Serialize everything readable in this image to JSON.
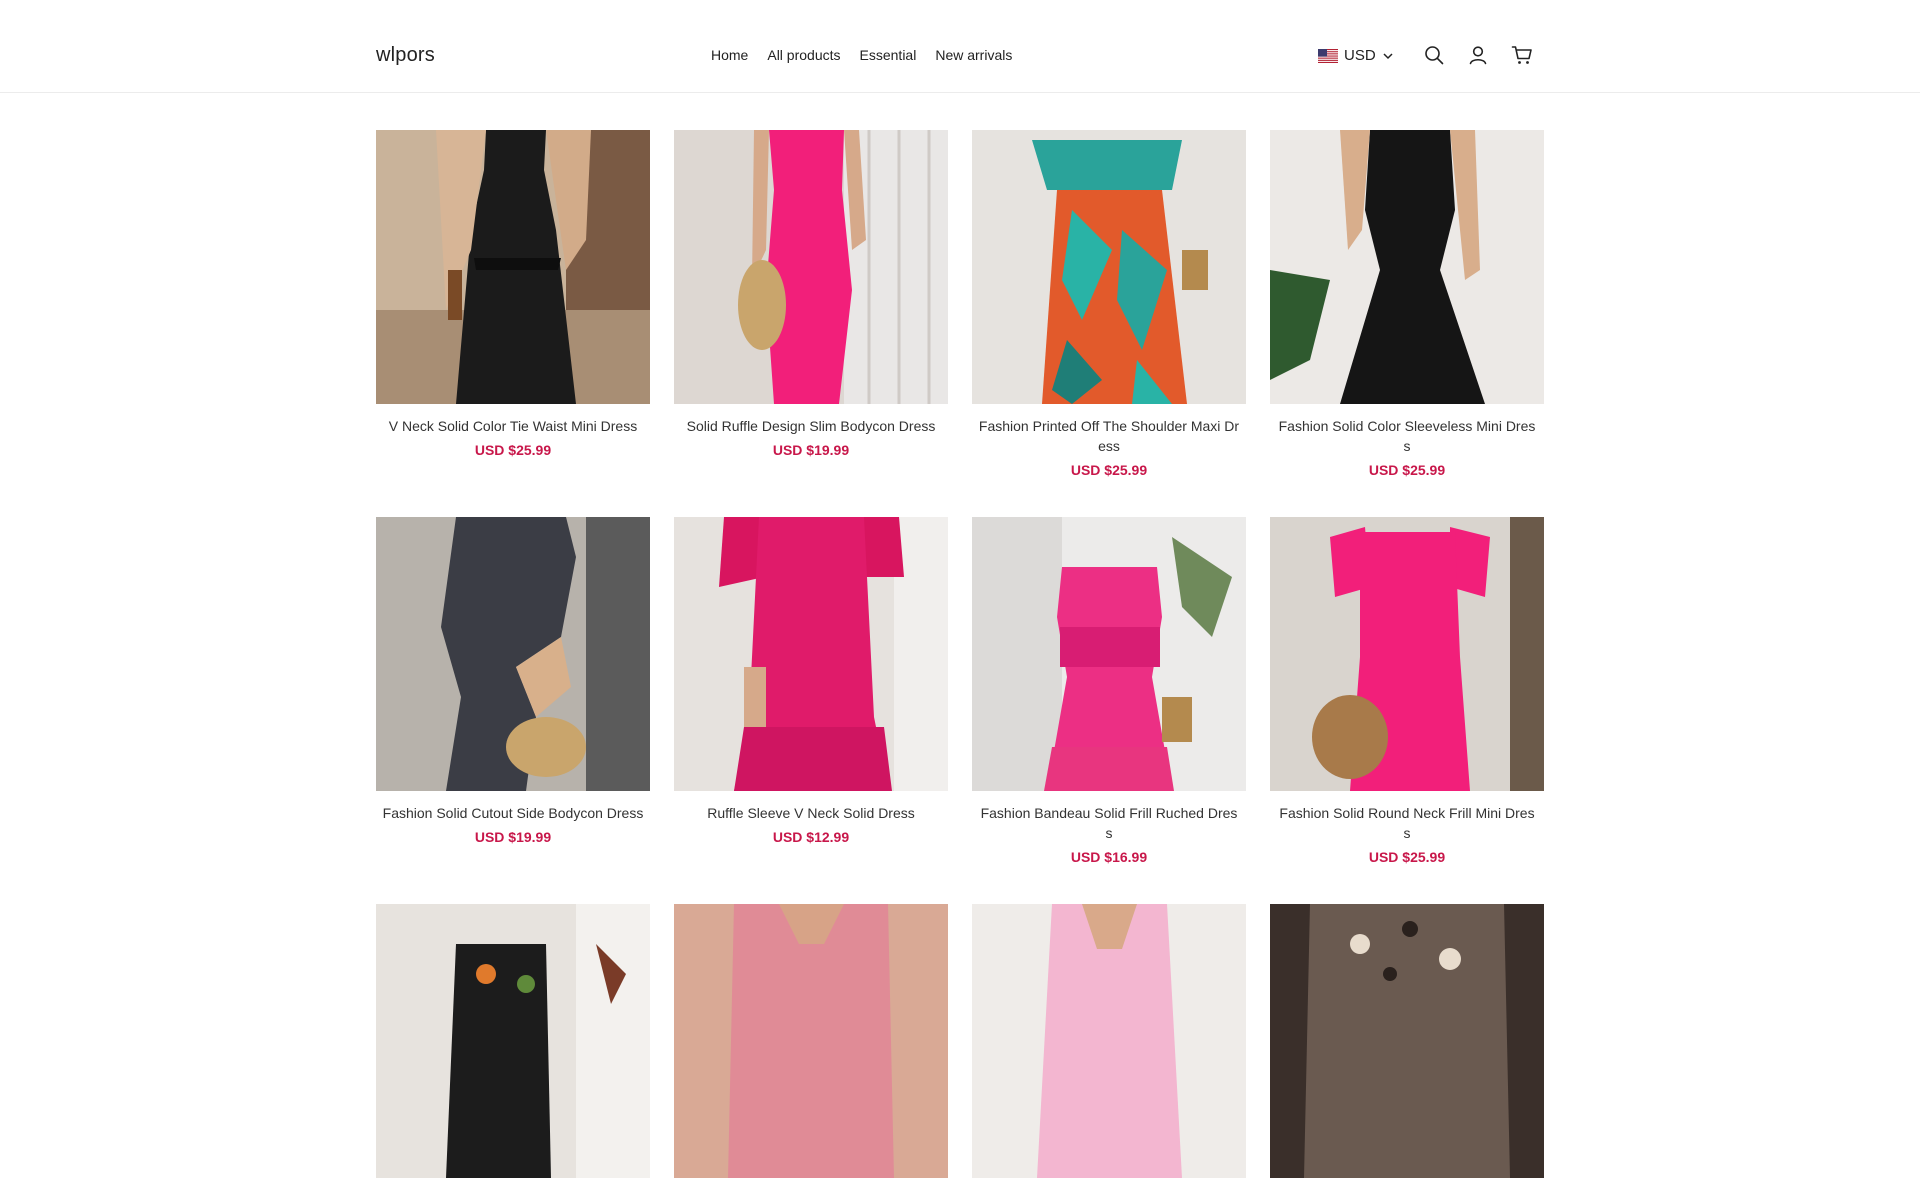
{
  "header": {
    "logo": "wlpors",
    "nav": [
      {
        "label": "Home"
      },
      {
        "label": "All products"
      },
      {
        "label": "Essential"
      },
      {
        "label": "New arrivals"
      }
    ],
    "currency": "USD"
  },
  "colors": {
    "price": "#c8174a",
    "accent_pink": "#f21f7a"
  },
  "products": [
    {
      "title": "V Neck Solid Color Tie Waist Mini Dress",
      "price": "USD $25.99"
    },
    {
      "title": "Solid Ruffle Design Slim Bodycon Dress",
      "price": "USD $19.99"
    },
    {
      "title": "Fashion Printed Off The Shoulder Maxi Dress",
      "price": "USD $25.99"
    },
    {
      "title": "Fashion Solid Color Sleeveless Mini Dress",
      "price": "USD $25.99"
    },
    {
      "title": "Fashion Solid Cutout Side Bodycon Dress",
      "price": "USD $19.99"
    },
    {
      "title": "Ruffle Sleeve V Neck Solid Dress",
      "price": "USD $12.99"
    },
    {
      "title": "Fashion Bandeau Solid Frill Ruched Dress",
      "price": "USD $16.99"
    },
    {
      "title": "Fashion Solid Round Neck Frill Mini Dress",
      "price": "USD $25.99"
    }
  ]
}
